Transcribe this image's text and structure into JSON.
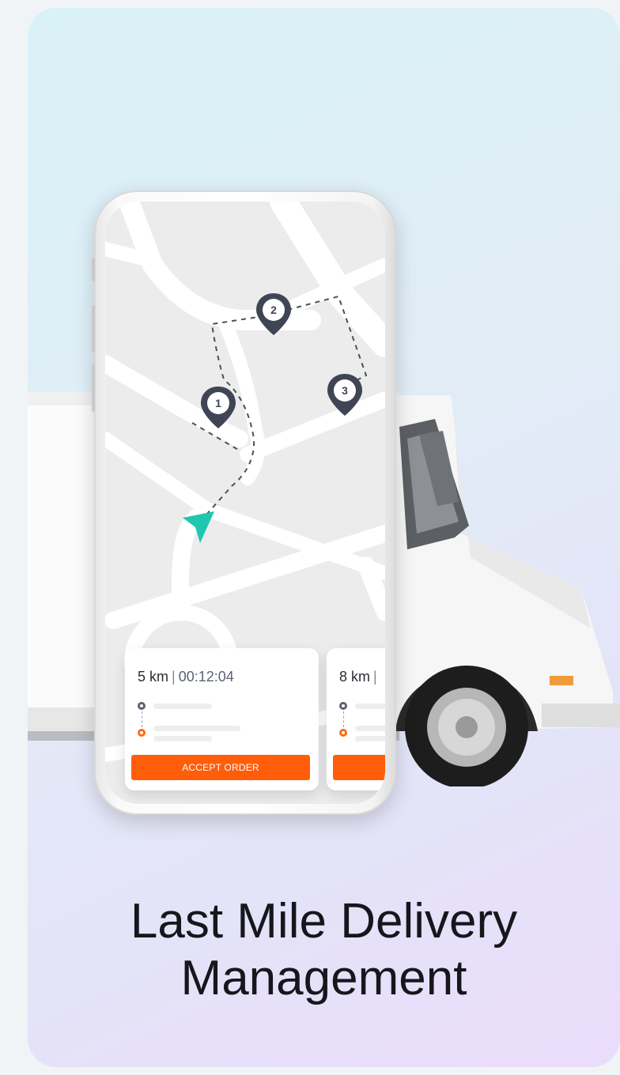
{
  "orders": [
    {
      "distance": "5 km",
      "time": "00:12:04",
      "button_label": "ACCEPT ORDER"
    },
    {
      "distance": "8 km",
      "time": "",
      "button_label": ""
    }
  ],
  "map": {
    "markers": [
      "1",
      "2",
      "3"
    ],
    "route_color": "#4a4f5c",
    "marker_color": "#3f4554",
    "navigation_arrow_color": "#1fc7b0"
  },
  "colors": {
    "accent": "#ff5d0a",
    "origin_dot": "#5b6270",
    "destination_dot": "#ff6a13"
  },
  "heading": {
    "line1": "Last Mile Delivery",
    "line2": "Management"
  }
}
